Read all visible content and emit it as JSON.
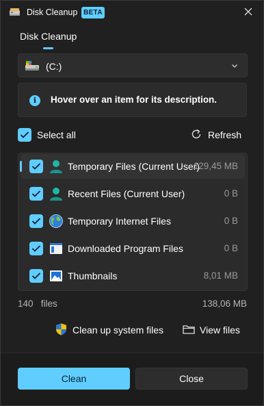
{
  "window": {
    "title": "Disk Cleanup",
    "badge": "BETA",
    "accent": "#60cdff"
  },
  "tab": {
    "label": "Disk Cleanup"
  },
  "drive": {
    "selected": "(C:)"
  },
  "info": {
    "text": "Hover over an item for its description."
  },
  "select_all": {
    "label": "Select all",
    "checked": true
  },
  "refresh": {
    "label": "Refresh"
  },
  "items": [
    {
      "name": "Temporary Files (Current User)",
      "size": "129,45 MB",
      "checked": true,
      "icon": "user-icon"
    },
    {
      "name": "Recent Files (Current User)",
      "size": "0 B",
      "checked": true,
      "icon": "user-icon"
    },
    {
      "name": "Temporary Internet Files",
      "size": "0 B",
      "checked": true,
      "icon": "globe-icon"
    },
    {
      "name": "Downloaded Program Files",
      "size": "0 B",
      "checked": true,
      "icon": "window-app-icon"
    },
    {
      "name": "Thumbnails",
      "size": "8,01 MB",
      "checked": true,
      "icon": "image-icon"
    }
  ],
  "summary": {
    "files_count": "140",
    "files_label": "files",
    "total": "138,06 MB"
  },
  "actions": {
    "system_files": "Clean up system files",
    "view_files": "View files"
  },
  "buttons": {
    "clean": "Clean",
    "close": "Close"
  }
}
